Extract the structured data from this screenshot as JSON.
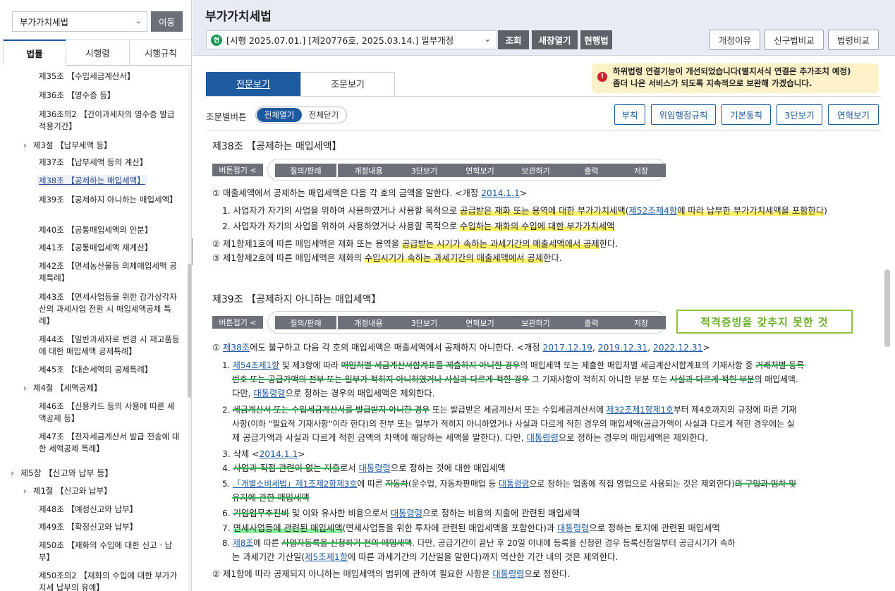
{
  "left": {
    "law_select": "부가가치세법",
    "move_button": "이동",
    "tabs": [
      "법률",
      "시행령",
      "시행규칙"
    ],
    "tree": [
      {
        "type": "art",
        "label": "제35조 【수입세금계산서】"
      },
      {
        "type": "art",
        "label": "제36조 【영수증 등】"
      },
      {
        "type": "art",
        "label": "제36조의2 【간이과세자의 영수증 발급 적용기간】"
      },
      {
        "type": "sec",
        "label": "제3절 【납부세액 등】"
      },
      {
        "type": "art",
        "label": "제37조 【납부세액 등의 계산】"
      },
      {
        "type": "art",
        "label": "제38조 【공제하는 매입세액】",
        "selected": true
      },
      {
        "type": "art",
        "label": "제39조 【공제하지 아니하는 매입세액】"
      },
      {
        "type": "art",
        "label": "제40조 【공통매입세액의 안분】"
      },
      {
        "type": "art",
        "label": "제41조 【공통매입세액 재계산】"
      },
      {
        "type": "art",
        "label": "제42조 【면세농산물등 의제매입세액 공제특례】"
      },
      {
        "type": "art",
        "label": "제43조 【면세사업등을 위한 감가상각자산의 과세사업 전환 시 매입세액공제 특례】"
      },
      {
        "type": "art",
        "label": "제44조 【일반과세자로 변경 시 재고품등에 대한 매입세액 공제특례】"
      },
      {
        "type": "art",
        "label": "제45조 【대손세액의 공제특례】"
      },
      {
        "type": "sec",
        "label": "제4절 【세액공제】"
      },
      {
        "type": "art",
        "label": "제46조 【신용카드 등의 사용에 따른 세액공제 등】"
      },
      {
        "type": "art",
        "label": "제47조 【전자세금계산서 발급 전송에 대한 세액공제 특례】"
      },
      {
        "type": "chap",
        "label": "제5장 【신고와 납부 등】"
      },
      {
        "type": "sec",
        "label": "제1절 【신고와 납부】"
      },
      {
        "type": "art",
        "label": "제48조 【예정신고와 납부】"
      },
      {
        "type": "art",
        "label": "제49조 【확정신고와 납부】"
      },
      {
        "type": "art",
        "label": "제50조 【재화의 수입에 대한 신고 · 납부】"
      },
      {
        "type": "art",
        "label": "제50조의2 【재화의 수입에 대한 부가가치세 납부의 유예】"
      }
    ]
  },
  "header": {
    "title": "부가가치세법",
    "version_badge": "현",
    "version": "[시행 2025.07.01.] [제20776호, 2025.03.14.] 일부개정",
    "buttons": [
      "조회",
      "새창열기",
      "현행법"
    ],
    "right_buttons": [
      "개정이유",
      "신구법비교",
      "법령비교"
    ]
  },
  "main": {
    "view_tabs": [
      "전문보기",
      "조문보기"
    ],
    "notice_line1": "하위법령 연결기능이 개선되었습니다(별지서식 연결은 추가조치 예정)",
    "notice_line2": "좀더 나은 서비스가 되도록 지속적으로 보완해 가겠습니다.",
    "toggle_label": "조문별버튼",
    "toggle_on": "전체열기",
    "toggle_off": "전체닫기",
    "right_buttons": [
      "부칙",
      "위임행정규칙",
      "기본통칙",
      "3단보기",
      "연혁보기"
    ],
    "fold_label": "버튼접기 <",
    "article_buttons": [
      "질의/판례",
      "개정내용",
      "3단보기",
      "연혁보기",
      "보관하기",
      "출력",
      "저장"
    ],
    "annotation": "적격증빙을 갖추지 못한 것",
    "art38": {
      "title": "제38조 【공제하는 매입세액】",
      "p1_a": "① 매출세액에서 공제하는 매입세액은 다음 각 호의 금액을 말한다. <개정 ",
      "p1_date": "2014.1.1",
      "p1_b": ">",
      "i1_a": "1. 사업자가 자기의 사업을 위하여 사용하였거나 사용할 목적으로 ",
      "i1_b": "공급받은 재화 또는 용역에 대한 부가가치세액",
      "i1_c": "(",
      "i1_link": "제52조제4항",
      "i1_d": "에 따라 납부한 부가가치세액을 포함한다",
      "i1_e": ")",
      "i2_a": "2. 사업자가 자기의 사업을 위하여 사용하였거나 사용할 목적으로 ",
      "i2_b": "수입하는 재화의 수입에 대한 부가가치세액",
      "p2_a": "② 제1항제1호에 따른 매입세액은 재화 또는 용역을 ",
      "p2_b": "공급받는 시기가 속하는 과세기간의 매출세액에서 공제",
      "p2_c": "한다.",
      "p3_a": "③ 제1항제2호에 따른 매입세액은 재화의 ",
      "p3_b": "수입시기가 속하는 과세기간의 매출세액에서 공제",
      "p3_c": "한다."
    },
    "art39": {
      "title": "제39조 【공제하지 아니하는 매입세액】",
      "p1_a": "① ",
      "p1_link": "제38조",
      "p1_b": "에도 불구하고 다음 각 호의 매입세액은 매출세액에서 공제하지 아니한다. <개정 ",
      "p1_d1": "2017.12.19",
      "p1_sep1": ", ",
      "p1_d2": "2019.12.31",
      "p1_sep2": ", ",
      "p1_d3": "2022.12.31",
      "p1_c": ">",
      "i1_link": "제54조제1항",
      "i1_l1_a": " 및 제3항에 따라 ",
      "i1_l1_b": "매입처별 세금계산서합계표를 제출하지 아니한 경우",
      "i1_l1_c": "의 매입세액 또는 제출한 매입처별 세금계산서합계표의 기재사항 중 ",
      "i1_l1_d": "거래처별 등록",
      "i1_l2_a": "번호 또는 공급가액의 전부 또는 일부가 적히지 아니하였거나 사실과 다르게 적힌 경우",
      "i1_l2_b": " 그 기재사항이 적히지 아니한 부분 또는 ",
      "i1_l2_c": "사실과 다르게 적힌 부분",
      "i1_l2_d": "의 매입세액.",
      "i1_l3_a": "다만, ",
      "i1_l3_link": "대통령령",
      "i1_l3_b": "으로 정하는 경우의 매입세액은 제외한다.",
      "i2_l1_a": "2. ",
      "i2_l1_b": "세금계산서 또는 수입세금계산서를 발급받지 아니한 경우",
      "i2_l1_c": " 또는 발급받은 세금계산서 또는 수입세금계산서에 ",
      "i2_l1_link": "제32조제1항제1호",
      "i2_l1_d": "부터 제4호까지의 규정에 따른 기재",
      "i2_l2": "사항(이하 \"필요적 기재사항\"이라 한다)의 전부 또는 일부가 적히지 아니하였거나 사실과 다르게 적힌 경우의 매입세액(공급가액이 사실과 다르게 적힌 경우에는 실",
      "i2_l3_a": "제 공급가액과 사실과 다르게 적힌 금액의 차액에 해당하는 세액을 말한다). 다만, ",
      "i2_l3_link": "대통령령",
      "i2_l3_b": "으로 정하는 경우의 매입세액은 제외한다.",
      "i3_a": "3. 삭제 <",
      "i3_date": "2014.1.1",
      "i3_b": ">",
      "i4_a": "4. ",
      "i4_b": "사업과 직접 관련이 없는 지출",
      "i4_c": "로서 ",
      "i4_link": "대통령령",
      "i4_d": "으로 정하는 것에 대한 매입세액",
      "i5_a": "5. ",
      "i5_link1": "「개별소비세법」제1조제2항제3호",
      "i5_b": "에 따른 ",
      "i5_c": "자동차",
      "i5_d": "(운수업, 자동차판매업 등 ",
      "i5_link2": "대통령령",
      "i5_e": "으로 정하는 업종에 직접 영업으로 사용되는 것은 제외한다)",
      "i5_f": "의 구입과 임차 및",
      "i5_l2": "유지에 관한 매입세액",
      "i6_a": "6. ",
      "i6_b": "기업업무추진비",
      "i6_c": " 및 이와 유사한 비용으로서 ",
      "i6_link": "대통령령",
      "i6_d": "으로 정하는 비용의 지출에 관련된 매입세액",
      "i7_a": "7. ",
      "i7_b": "면세사업등에 관련된 매입세액",
      "i7_c": "(면세사업등을 위한 투자에 관련된 매입세액을 포함한다)과 ",
      "i7_link": "대통령령",
      "i7_d": "으로 정하는 토지에 관련된 매입세액",
      "i8_a": "8. ",
      "i8_link": "제8조",
      "i8_b": "에 따른 ",
      "i8_c": "사업자등록을 신청하기 전의 매입세액",
      "i8_d": ". 다만, 공급기간이 끝난 후 20일 이내에 등록을 신청한 경우 등록신청일부터 공급시기가 속하",
      "i8_l2_a": "는 과세기간 기산일(",
      "i8_l2_link": "제5조제1항",
      "i8_l2_b": "에 따른 과세기간의 기산일을 말한다)까지 역산한 기간 내의 것은 제외한다.",
      "p2_a": "② 제1항에 따라 공제되지 아니하는 매입세액의 범위에 관하여 필요한 사항은 ",
      "p2_link": "대통령령",
      "p2_b": "으로 정한다."
    }
  }
}
